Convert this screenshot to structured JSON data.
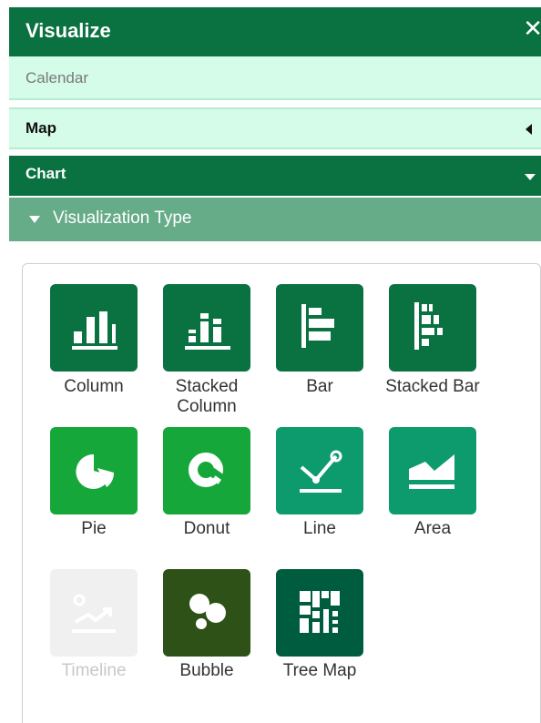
{
  "header": {
    "title": "Visualize",
    "close_glyph": "✕"
  },
  "sections": {
    "calendar": "Calendar",
    "map": "Map",
    "chart": "Chart",
    "vis_type": "Visualization Type"
  },
  "colors": {
    "dark_green": "#0a7141",
    "bright_green": "#16a73a",
    "teal": "#0d9b6e",
    "olive": "#2d5116",
    "deep_green": "#005c3e",
    "disabled": "#f0f0f0"
  },
  "chart_types": [
    {
      "label": "Column",
      "icon": "column-chart-icon",
      "enabled": true
    },
    {
      "label": "Stacked Column",
      "icon": "stacked-column-chart-icon",
      "enabled": true
    },
    {
      "label": "Bar",
      "icon": "bar-chart-icon",
      "enabled": true
    },
    {
      "label": "Stacked Bar",
      "icon": "stacked-bar-chart-icon",
      "enabled": true
    },
    {
      "label": "Pie",
      "icon": "pie-chart-icon",
      "enabled": true
    },
    {
      "label": "Donut",
      "icon": "donut-chart-icon",
      "enabled": true
    },
    {
      "label": "Line",
      "icon": "line-chart-icon",
      "enabled": true
    },
    {
      "label": "Area",
      "icon": "area-chart-icon",
      "enabled": true
    },
    {
      "label": "Timeline",
      "icon": "timeline-chart-icon",
      "enabled": false
    },
    {
      "label": "Bubble",
      "icon": "bubble-chart-icon",
      "enabled": true
    },
    {
      "label": "Tree Map",
      "icon": "tree-map-icon",
      "enabled": true
    }
  ]
}
